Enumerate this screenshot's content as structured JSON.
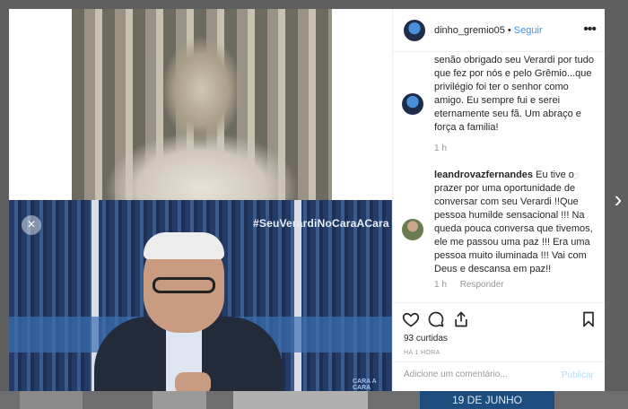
{
  "post": {
    "username": "dinho_gremio05",
    "follow_label": "Seguir",
    "separator": "•",
    "more_label": "•••",
    "hashtag_overlay": "#SeuVerardiNoCaraACara",
    "corner_logo": "CARA A CARA"
  },
  "comments": [
    {
      "user": "",
      "text": "senão obrigado seu Verardi por tudo que fez por nós e pelo Grêmio...que privilégio foi ter o senhor como amigo. Eu sempre fui e serei eternamente seu fã. Um abraço e força a familia!",
      "time": "1 h",
      "reply_label": ""
    },
    {
      "user": "leandrovazfernandes",
      "text": "Eu tive o prazer por uma oportunidade de conversar com seu Verardi !!Que pessoa humilde sensacional !!! Na queda pouca conversa que tivemos, ele me passou uma paz !!! Era uma pessoa muito iluminada !!! Vai com Deus e descansa em paz!!",
      "time": "1 h",
      "reply_label": "Responder"
    }
  ],
  "stats": {
    "likes": "93 curtidas",
    "posted": "HÁ 1 HORA"
  },
  "comment_input": {
    "placeholder": "Adicione um comentário...",
    "publish_label": "Publicar"
  },
  "controls": {
    "close_label": "×",
    "next_label": "›"
  },
  "background": {
    "thumb_text": "19 DE JUNHO"
  },
  "colors": {
    "accent": "#3897f0",
    "publish_disabled": "#b2dffc"
  },
  "icons": [
    "heart-icon",
    "comment-icon",
    "share-icon",
    "bookmark-icon",
    "close-icon",
    "chevron-right-icon",
    "more-icon"
  ]
}
